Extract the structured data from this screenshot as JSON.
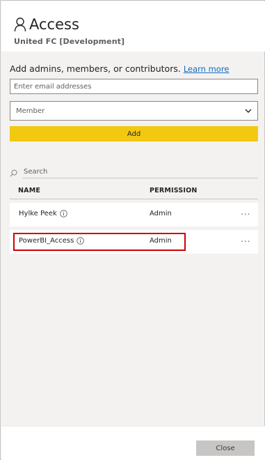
{
  "header": {
    "title": "Access",
    "workspace": "United FC [Development]"
  },
  "add": {
    "prompt": "Add admins, members, or contributors.",
    "learn_more": "Learn more",
    "email_placeholder": "Enter email addresses",
    "role_selected": "Member",
    "add_label": "Add"
  },
  "search": {
    "placeholder": "Search"
  },
  "table": {
    "columns": [
      "NAME",
      "PERMISSION"
    ],
    "rows": [
      {
        "name": "Hylke Peek",
        "permission": "Admin",
        "more": "..."
      },
      {
        "name": "PowerBI_Access",
        "permission": "Admin",
        "more": "..."
      }
    ]
  },
  "footer": {
    "close_label": "Close"
  },
  "colors": {
    "accent": "#f2c811",
    "highlight": "#d00000",
    "link": "#0f6cbd"
  }
}
